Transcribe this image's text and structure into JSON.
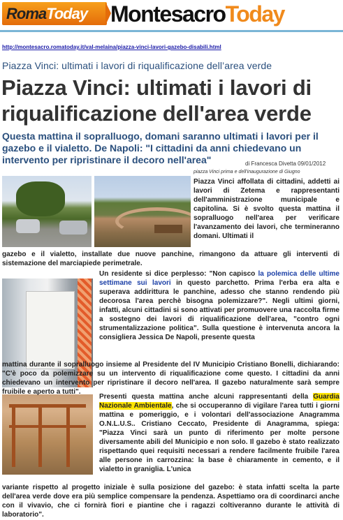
{
  "header": {
    "logo_left_a": "Roma",
    "logo_left_b": "Today",
    "logo_right_a": "Montesacro",
    "logo_right_b": "Today",
    "colors": {
      "orange": "#f08a1c",
      "rule": "#7ab5d6",
      "heading_blue": "#2a4f7d"
    }
  },
  "article": {
    "url": "http://montesacro.romatoday.it/val-melaina/piazza-vinci-lavori-gazebo-disabili.html",
    "kicker": "Piazza Vinci: ultimati i lavori di riqualificazione dell’area verde",
    "title_line1": "Piazza Vinci: ultimati i lavori di",
    "title_line2": "riqualificazione dell'area verde",
    "subtitle": "Questa mattina il sopralluogo, domani saranno ultimati i lavori per il gazebo e il vialetto. De Napoli: \"I cittadini da anni chiedevano un intervento per ripristinare il decoro nell'area\"",
    "byline": "di Francesca Divetta 09/01/2012",
    "photo_caption": "piazza Vinci prima e dell'inaugurazione di Giugno",
    "p1": "Piazza Vinci affollata di cittadini, addetti ai lavori di Zetema e rappresentanti dell'amministrazione municipale e capitolina. Si è svolto questa mattina il sopralluogo nell'area per verificare l'avanzamento dei lavori, che termineranno domani. Ultimati il",
    "p1_full": "gazebo e il vialetto, installate due nuove panchine, rimangono da attuare gli interventi di sistemazione del marciapiede perimetrale.",
    "p2_a": "Un residente si dice perplesso: \"Non capisco ",
    "p2_link": "la polemica delle ultime settimane sui lavori",
    "p2_b": " in questo parchetto. Prima l'erba era alta e superava addirittura le panchine, adesso che stanno rendendo più decorosa l'area perchè bisogna polemizzare?\". Negli ultimi giorni, infatti, alcuni cittadini si sono attivati per promuovere una raccolta firme a sostegno dei lavori di riqualificazione dell'area, \"contro ogni strumentalizzazione politica\". Sulla questione è intervenuta ancora la consigliera Jessica De Napoli, presente questa",
    "p2_full": "mattina durante il sopralluogo insieme al Presidente del IV Municipio Cristiano Bonelli, dichiarando: \"C'è poco da polemizzare su un intervento di riqualificazione come questo. I cittadini da anni chiedevano un intervento per ripristinare il decoro nell'area. Il gazebo naturalmente sarà sempre fruibile e aperto a tutti\".",
    "p3_a": "Presenti questa mattina anche alcuni rappresentanti della ",
    "p3_hl": "Guardia Nazionale Ambientale",
    "p3_b": ", che si occuperanno di vigilare l'area tutti i giorni mattina e pomeriggio, e i volontari dell'associazione Anagramma O.N.L.U.S.. Cristiano Ceccato, Presidente di Anagramma, spiega: \"Piazza Vinci sarà un punto di riferimento per molte persone diversamente abili del Municipio e non solo. Il gazebo è stato realizzato rispettando quei requisiti necessari a rendere facilmente fruibile l'area alle persone in carrozzina: la base è chiaramente in cemento, e il vialetto in graniglia. L'unica",
    "p3_full": "variante rispetto al progetto iniziale è sulla posizione del gazebo: è stata infatti scelta la parte dell'area verde dove era più semplice compensare la pendenza. Aspettiamo ora di coordinarci anche con il vivavio, che ci fornirà fiori e piantine che i ragazzi coltiveranno durante le attività di laboratorio\"."
  }
}
